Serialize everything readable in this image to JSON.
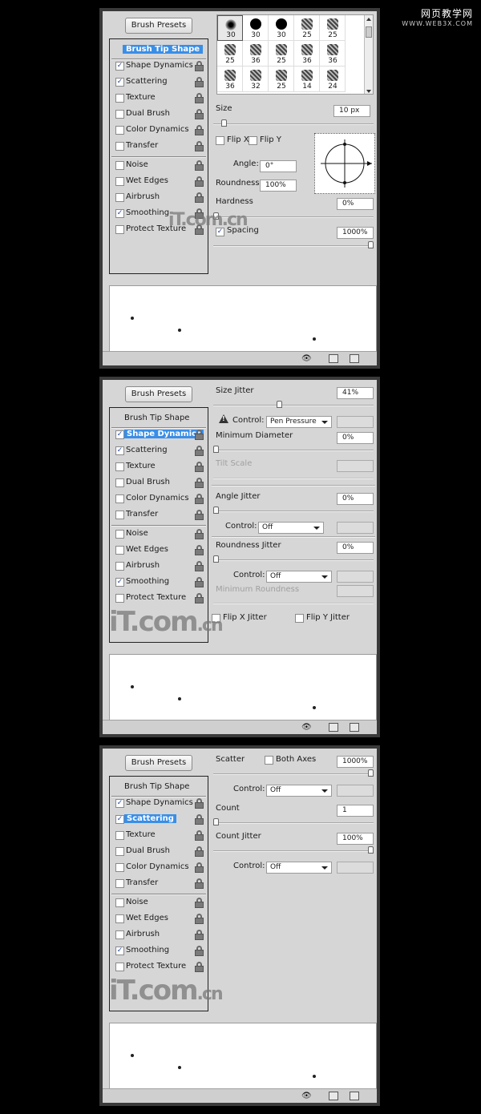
{
  "watermark": {
    "title": "网页教学网",
    "url": "WWW.WEB3X.COM"
  },
  "presets_label": "Brush Presets",
  "options": [
    {
      "label": "Brush Tip Shape",
      "checkbox": false
    },
    {
      "label": "Shape Dynamics",
      "checkbox": true
    },
    {
      "label": "Scattering",
      "checkbox": true
    },
    {
      "label": "Texture",
      "checkbox": true
    },
    {
      "label": "Dual Brush",
      "checkbox": true
    },
    {
      "label": "Color Dynamics",
      "checkbox": true
    },
    {
      "label": "Transfer",
      "checkbox": true
    },
    {
      "label": "Noise",
      "checkbox": true
    },
    {
      "label": "Wet Edges",
      "checkbox": true
    },
    {
      "label": "Airbrush",
      "checkbox": true
    },
    {
      "label": "Smoothing",
      "checkbox": true
    },
    {
      "label": "Protect Texture",
      "checkbox": true
    }
  ],
  "checked_states": {
    "shape_dynamics": true,
    "scattering": true,
    "smoothing": true
  },
  "brush_grid": [
    [
      {
        "n": "30",
        "k": "soft"
      },
      {
        "n": "30",
        "k": "hard"
      },
      {
        "n": "30",
        "k": "hard"
      },
      {
        "n": "25",
        "k": "tex"
      },
      {
        "n": "25",
        "k": "tex"
      }
    ],
    [
      {
        "n": "25",
        "k": "tex"
      },
      {
        "n": "36",
        "k": "tex"
      },
      {
        "n": "25",
        "k": "tex"
      },
      {
        "n": "36",
        "k": "tex"
      },
      {
        "n": "36",
        "k": "tex"
      }
    ],
    [
      {
        "n": "36",
        "k": "tex"
      },
      {
        "n": "32",
        "k": "tex"
      },
      {
        "n": "25",
        "k": "tex"
      },
      {
        "n": "14",
        "k": "tex"
      },
      {
        "n": "24",
        "k": "tex"
      }
    ]
  ],
  "panel1": {
    "size_label": "Size",
    "size_value": "10 px",
    "size_level": 0.05,
    "flip_x": "Flip X",
    "flip_y": "Flip Y",
    "angle_label": "Angle:",
    "angle_value": "0°",
    "roundness_label": "Roundness:",
    "roundness_value": "100%",
    "hardness_label": "Hardness",
    "hardness_value": "0%",
    "hardness_level": 0,
    "spacing_label": "Spacing",
    "spacing_value": "1000%",
    "spacing_level": 1
  },
  "panel2": {
    "size_jitter_label": "Size Jitter",
    "size_jitter_value": "41%",
    "size_jitter_level": 0.41,
    "control_label": "Control:",
    "control_value": "Pen Pressure",
    "min_diameter_label": "Minimum Diameter",
    "min_diameter_value": "0%",
    "tilt_scale_label": "Tilt Scale",
    "angle_jitter_label": "Angle Jitter",
    "angle_jitter_value": "0%",
    "angle_control_label": "Control:",
    "angle_control_value": "Off",
    "roundness_jitter_label": "Roundness Jitter",
    "roundness_jitter_value": "0%",
    "roundness_control_label": "Control:",
    "roundness_control_value": "Off",
    "min_roundness_label": "Minimum Roundness",
    "flip_x_jitter": "Flip X Jitter",
    "flip_y_jitter": "Flip Y Jitter"
  },
  "panel3": {
    "scatter_label": "Scatter",
    "both_axes_label": "Both Axes",
    "scatter_value": "1000%",
    "scatter_level": 1,
    "scatter_control_label": "Control:",
    "scatter_control_value": "Off",
    "count_label": "Count",
    "count_value": "1",
    "count_level": 0,
    "count_jitter_label": "Count Jitter",
    "count_jitter_value": "100%",
    "count_jitter_level": 1,
    "count_control_label": "Control:",
    "count_control_value": "Off"
  },
  "watermark_logo": {
    "main": "iT.com",
    "suffix": ".cn"
  }
}
